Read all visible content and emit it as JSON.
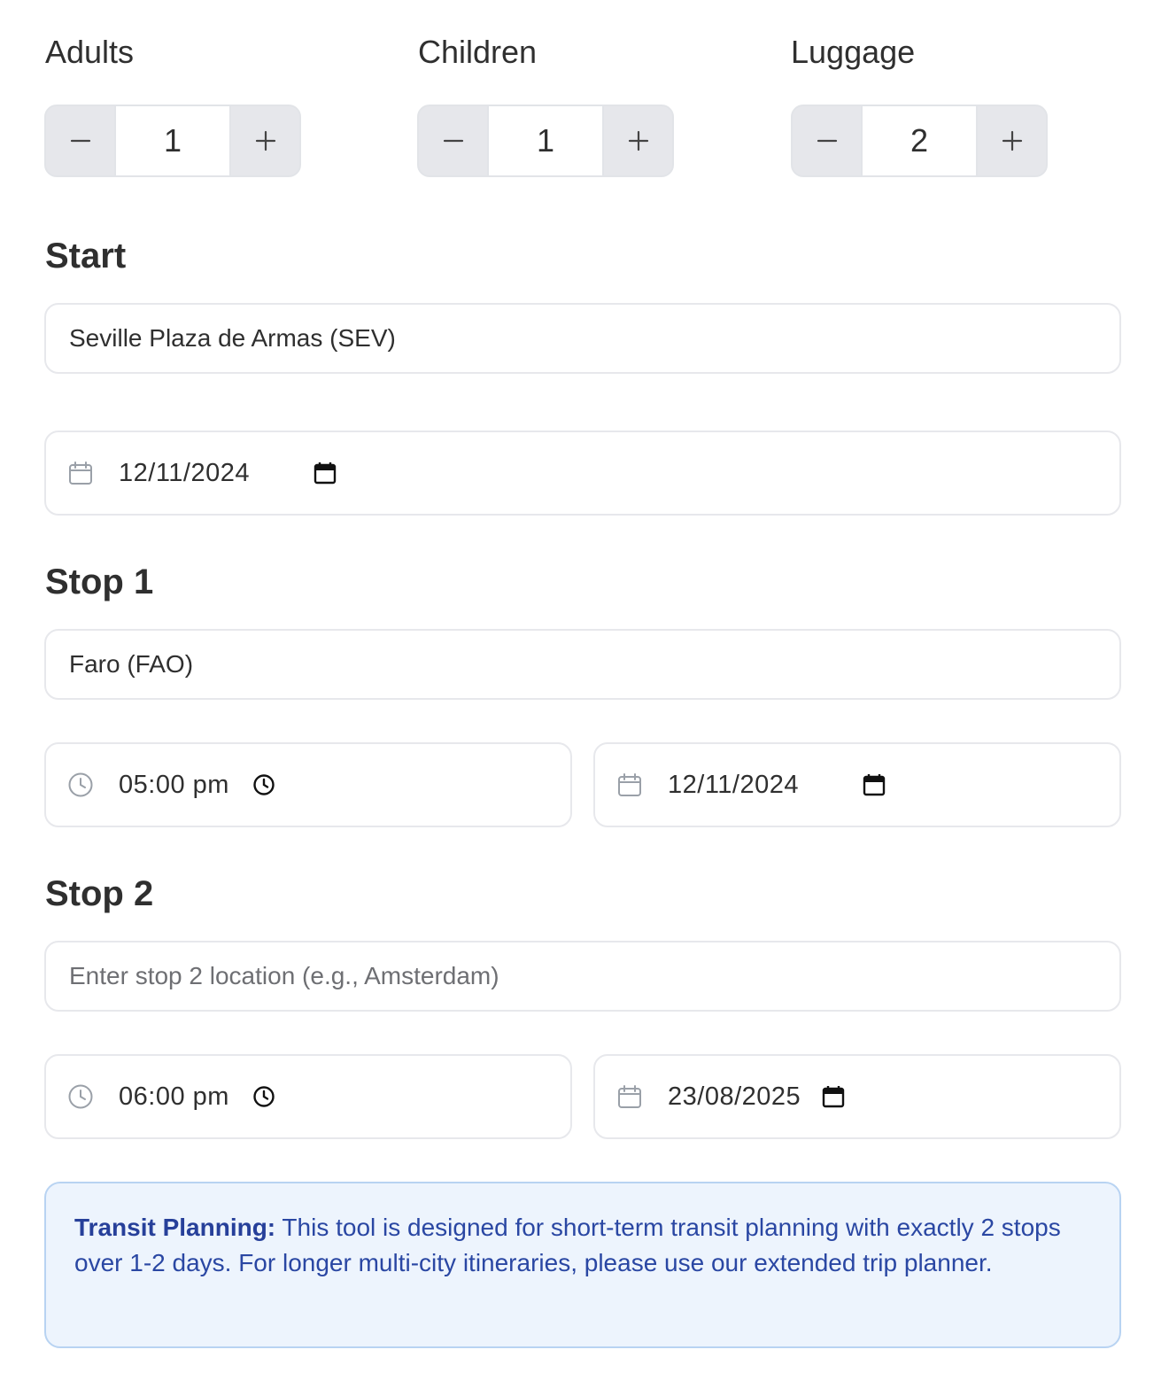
{
  "counters": {
    "adults": {
      "label": "Adults",
      "value": "1"
    },
    "children": {
      "label": "Children",
      "value": "1"
    },
    "luggage": {
      "label": "Luggage",
      "value": "2"
    }
  },
  "start": {
    "title": "Start",
    "location_value": "Seville Plaza de Armas (SEV)",
    "date": "12/11/2024"
  },
  "stop1": {
    "title": "Stop 1",
    "location_value": "Faro (FAO)",
    "time": "05:00 pm",
    "date": "12/11/2024"
  },
  "stop2": {
    "title": "Stop 2",
    "location_placeholder": "Enter stop 2 location (e.g., Amsterdam)",
    "time": "06:00 pm",
    "date": "23/08/2025"
  },
  "notice": {
    "heading": "Transit Planning:",
    "body": "This tool is designed for short-term transit planning with exactly 2 stops over 1-2 days. For longer multi-city itineraries, please use our extended trip planner."
  },
  "icons": {
    "minus": "minus-icon",
    "plus": "plus-icon",
    "calendar": "calendar-icon",
    "clock": "clock-icon"
  },
  "colors": {
    "notice_bg": "#edf4fd",
    "notice_border": "#b8d3f2",
    "notice_text": "#2a47a3",
    "stepper_bg": "#e6e7eb"
  }
}
